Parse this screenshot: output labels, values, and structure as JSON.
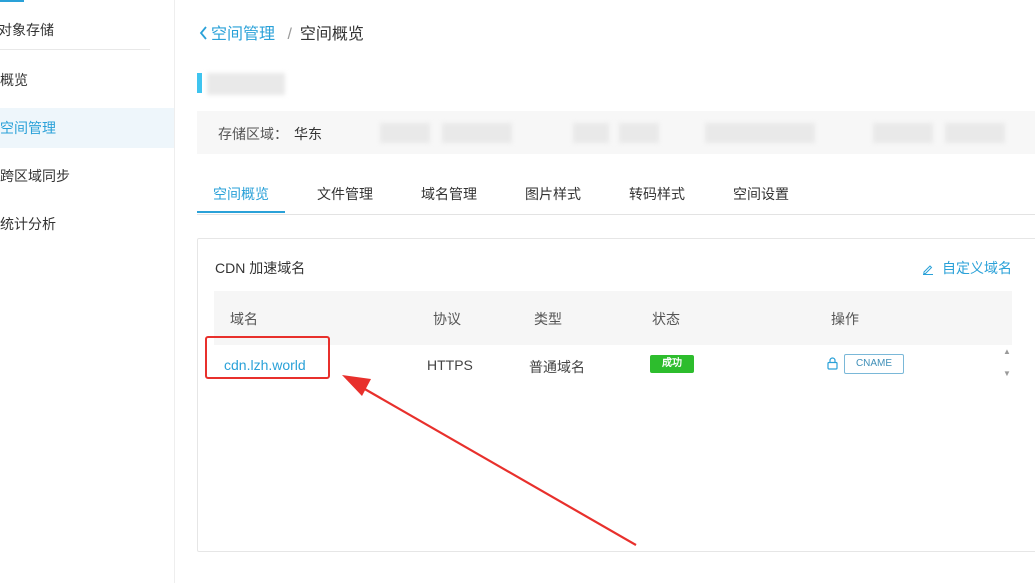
{
  "sidebar": {
    "title": "对象存储",
    "items": [
      {
        "label": "概览"
      },
      {
        "label": "空间管理"
      },
      {
        "label": "跨区域同步"
      },
      {
        "label": "统计分析"
      }
    ]
  },
  "breadcrumb": {
    "back": "空间管理",
    "separator": "/",
    "current": "空间概览"
  },
  "info": {
    "region_label": "存储区域：",
    "region_value": "华东"
  },
  "tabs": [
    "空间概览",
    "文件管理",
    "域名管理",
    "图片样式",
    "转码样式",
    "空间设置"
  ],
  "card": {
    "title": "CDN 加速域名",
    "custom_link": "自定义域名",
    "columns": [
      "域名",
      "协议",
      "类型",
      "状态",
      "操作"
    ],
    "rows": [
      {
        "domain": "cdn.lzh.world",
        "protocol": "HTTPS",
        "type": "普通域名",
        "status": "成功",
        "action": "CNAME"
      }
    ]
  },
  "colors": {
    "accent": "#2aa1d8",
    "success": "#2dbd2d",
    "annotation": "#e8302c"
  }
}
